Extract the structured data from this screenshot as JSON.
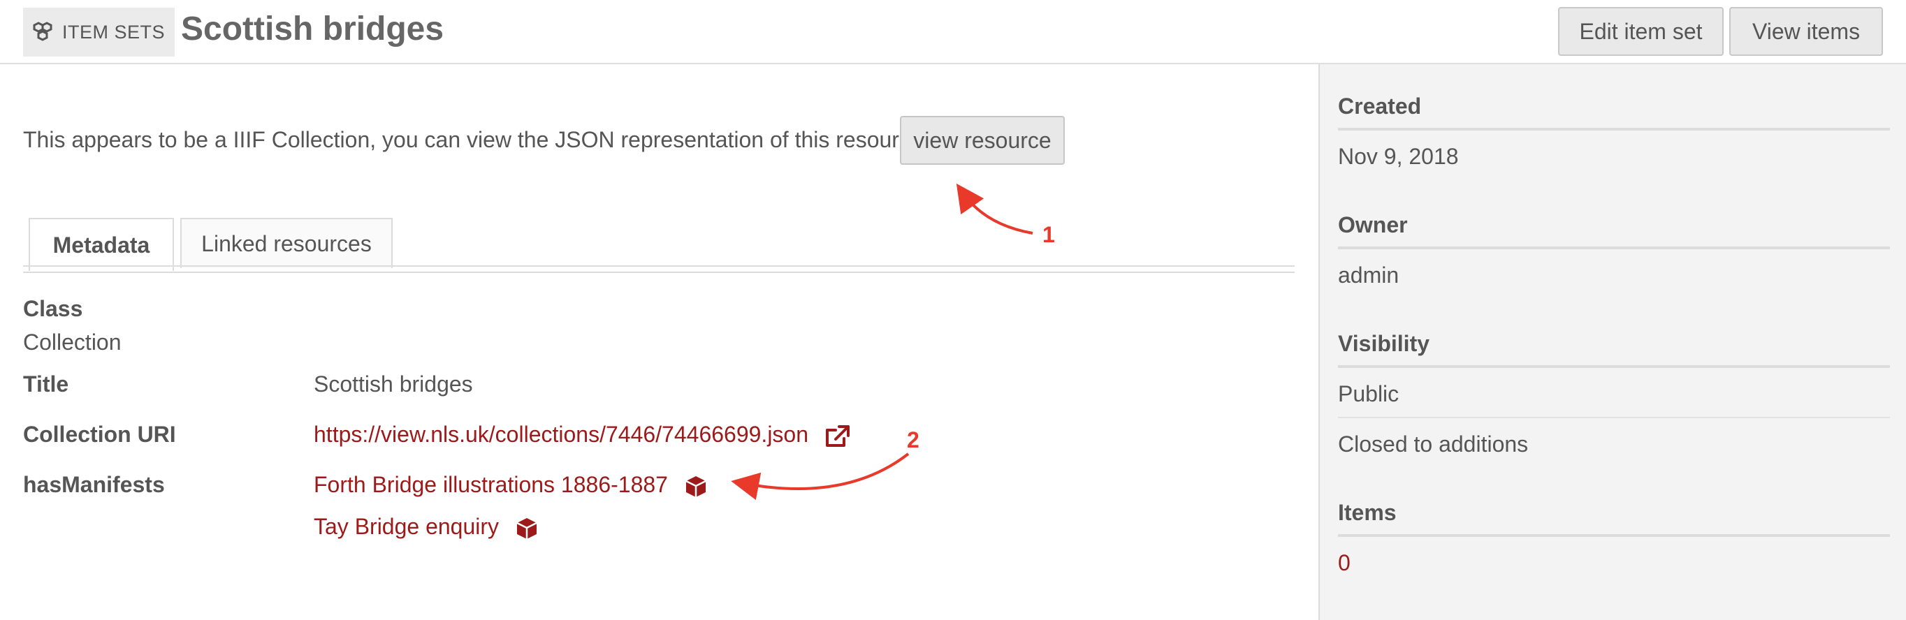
{
  "header": {
    "section_label": "ITEM SETS",
    "title": "Scottish bridges",
    "edit_button": "Edit item set",
    "view_items_button": "View items"
  },
  "intro": {
    "text": "This appears to be a IIIF Collection, you can view the JSON representation of this resource",
    "button": "view resource"
  },
  "tabs": [
    {
      "label": "Metadata",
      "active": true
    },
    {
      "label": "Linked resources",
      "active": false
    }
  ],
  "metadata": {
    "class_label": "Class",
    "class_value": "Collection",
    "title_label": "Title",
    "title_value": "Scottish bridges",
    "uri_label": "Collection URI",
    "uri_value": "https://view.nls.uk/collections/7446/74466699.json",
    "manifests_label": "hasManifests",
    "manifests": [
      "Forth Bridge illustrations 1886-1887",
      "Tay Bridge enquiry"
    ]
  },
  "sidebar": {
    "created_label": "Created",
    "created_value": "Nov 9, 2018",
    "owner_label": "Owner",
    "owner_value": "admin",
    "visibility_label": "Visibility",
    "visibility_value": "Public",
    "additions_value": "Closed to additions",
    "items_label": "Items",
    "items_value": "0"
  },
  "annotations": [
    "1",
    "2"
  ],
  "colors": {
    "link": "#9d1a1a",
    "annotation": "#e8392a",
    "sidebar_bg": "#f3f3f3"
  },
  "icons": [
    "item-sets-icon",
    "external-link-icon",
    "cube-icon"
  ]
}
